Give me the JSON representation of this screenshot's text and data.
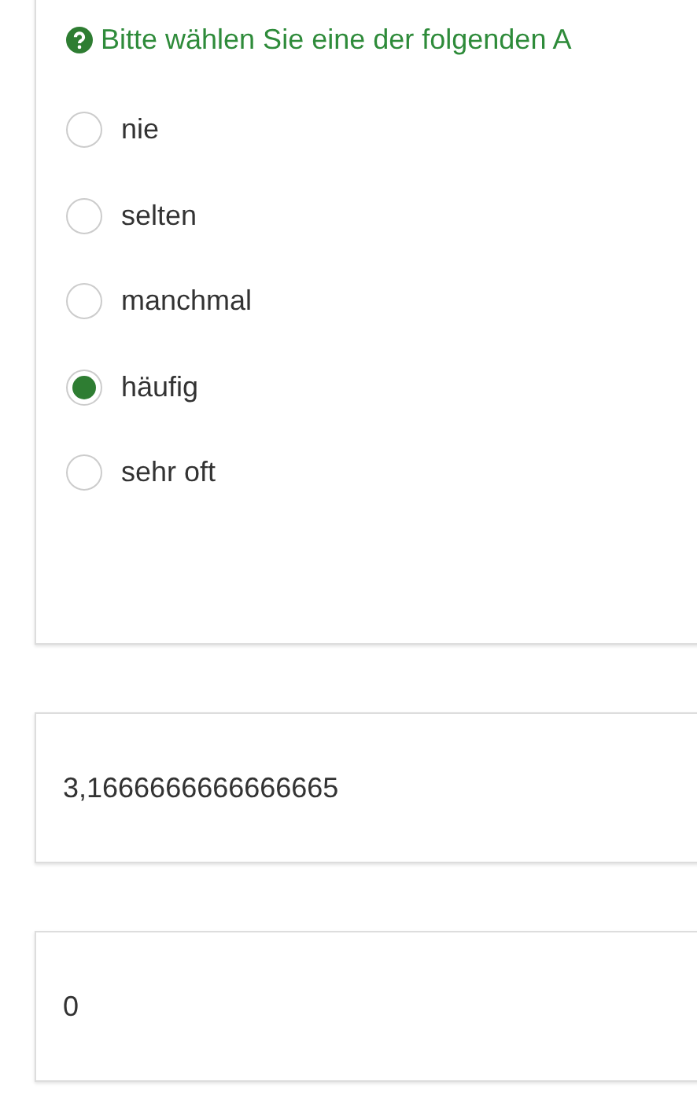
{
  "question": {
    "prompt": "Bitte wählen Sie eine der folgenden A",
    "options": [
      {
        "label": "nie",
        "selected": false
      },
      {
        "label": "selten",
        "selected": false
      },
      {
        "label": "manchmal",
        "selected": false
      },
      {
        "label": "häufig",
        "selected": true
      },
      {
        "label": "sehr oft",
        "selected": false
      }
    ]
  },
  "results": [
    {
      "value": "3,1666666666666665"
    },
    {
      "value": "0"
    }
  ]
}
